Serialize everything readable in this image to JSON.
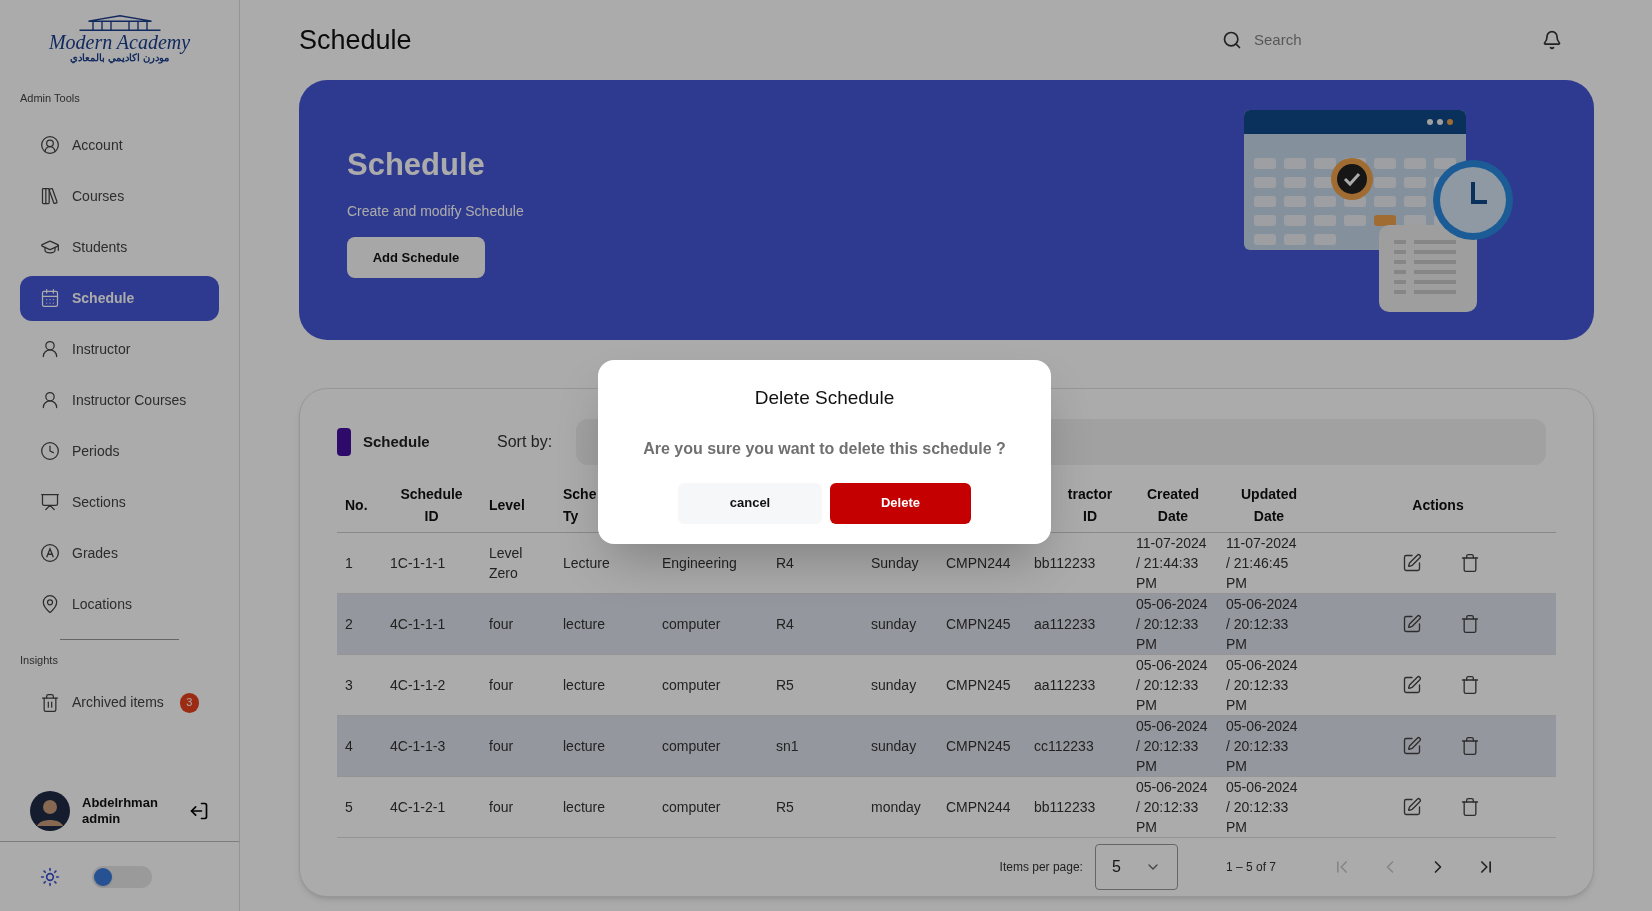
{
  "sidebar": {
    "logo": {
      "name": "Modern Academy",
      "arabic": "مودرن اكاديمي بالمعادي"
    },
    "sections": [
      {
        "heading": "Admin Tools",
        "items": [
          {
            "label": "Account",
            "kind": "account",
            "selected": false
          },
          {
            "label": "Courses",
            "kind": "courses",
            "selected": false
          },
          {
            "label": "Students",
            "kind": "students",
            "selected": false
          },
          {
            "label": "Schedule",
            "kind": "schedule",
            "selected": true
          },
          {
            "label": "Instructor",
            "kind": "instructor",
            "selected": false
          },
          {
            "label": "Instructor Courses",
            "kind": "instructor",
            "selected": false
          },
          {
            "label": "Periods",
            "kind": "periods",
            "selected": false
          },
          {
            "label": "Sections",
            "kind": "sections",
            "selected": false
          },
          {
            "label": "Grades",
            "kind": "grades",
            "selected": false
          },
          {
            "label": "Locations",
            "kind": "locations",
            "selected": false
          }
        ]
      },
      {
        "heading": "Insights",
        "items": [
          {
            "label": "Archived items",
            "kind": "archive",
            "selected": false,
            "badge": "3"
          }
        ]
      }
    ],
    "user": {
      "name": "Abdelrhman",
      "role": "admin"
    },
    "theme_toggle": {
      "on": false
    }
  },
  "header": {
    "title": "Schedule",
    "search": {
      "placeholder": "Search"
    }
  },
  "banner": {
    "title": "Schedule",
    "subtitle": "Create and modify Schedule",
    "button": "Add Schedule"
  },
  "table_card": {
    "title": "Schedule",
    "sort_label": "Sort by:",
    "header": {
      "no": "No.",
      "schedule_id": "Schedule ID",
      "level": "Level",
      "column_4": "Sche Ty",
      "column_9": "tractor ID",
      "created_date": "Created Date",
      "updated_date": "Updated Date",
      "actions": "Actions"
    },
    "rows": [
      {
        "shaded": false,
        "cells": [
          "1",
          "1C-1-1-1",
          "Level Zero",
          "Lecture",
          "Engineering",
          "R4",
          "Sunday",
          "CMPN244",
          "bb112233",
          "11-07-2024 / 21:44:33 PM",
          "11-07-2024 / 21:46:45 PM"
        ]
      },
      {
        "shaded": true,
        "cells": [
          "2",
          "4C-1-1-1",
          "four",
          "lecture",
          "computer",
          "R4",
          "sunday",
          "CMPN245",
          "aa112233",
          "05-06-2024 / 20:12:33 PM",
          "05-06-2024 / 20:12:33 PM"
        ]
      },
      {
        "shaded": false,
        "cells": [
          "3",
          "4C-1-1-2",
          "four",
          "lecture",
          "computer",
          "R5",
          "sunday",
          "CMPN245",
          "aa112233",
          "05-06-2024 / 20:12:33 PM",
          "05-06-2024 / 20:12:33 PM"
        ]
      },
      {
        "shaded": true,
        "cells": [
          "4",
          "4C-1-1-3",
          "four",
          "lecture",
          "computer",
          "sn1",
          "sunday",
          "CMPN245",
          "cc112233",
          "05-06-2024 / 20:12:33 PM",
          "05-06-2024 / 20:12:33 PM"
        ]
      },
      {
        "shaded": false,
        "cells": [
          "5",
          "4C-1-2-1",
          "four",
          "lecture",
          "computer",
          "R5",
          "monday",
          "CMPN244",
          "bb112233",
          "05-06-2024 / 20:12:33 PM",
          "05-06-2024 / 20:12:33 PM"
        ]
      }
    ],
    "pagination": {
      "label": "Items per page:",
      "page_size": "5",
      "range": "1 – 5 of 7",
      "first_disabled": true,
      "prev_disabled": true,
      "next_disabled": false,
      "last_disabled": false
    }
  },
  "dialog": {
    "title": "Delete Schedule",
    "message": "Are you sure you want to delete this schedule ?",
    "cancel": "cancel",
    "confirm": "Delete"
  }
}
